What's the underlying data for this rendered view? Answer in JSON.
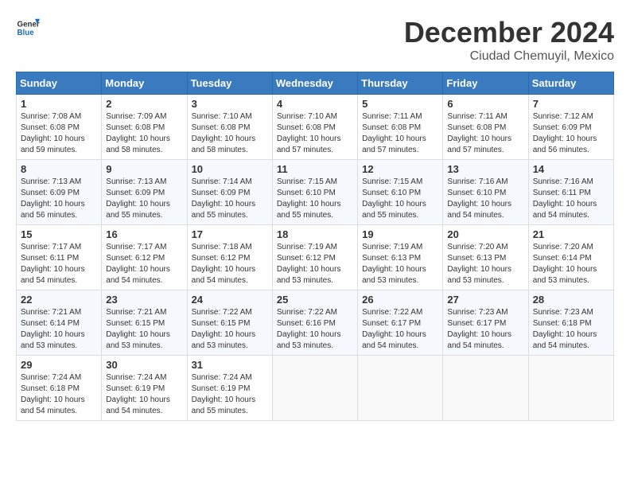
{
  "logo": {
    "general": "General",
    "blue": "Blue"
  },
  "header": {
    "month": "December 2024",
    "location": "Ciudad Chemuyil, Mexico"
  },
  "weekdays": [
    "Sunday",
    "Monday",
    "Tuesday",
    "Wednesday",
    "Thursday",
    "Friday",
    "Saturday"
  ],
  "weeks": [
    [
      {
        "day": "1",
        "sunrise": "Sunrise: 7:08 AM",
        "sunset": "Sunset: 6:08 PM",
        "daylight": "Daylight: 10 hours and 59 minutes."
      },
      {
        "day": "2",
        "sunrise": "Sunrise: 7:09 AM",
        "sunset": "Sunset: 6:08 PM",
        "daylight": "Daylight: 10 hours and 58 minutes."
      },
      {
        "day": "3",
        "sunrise": "Sunrise: 7:10 AM",
        "sunset": "Sunset: 6:08 PM",
        "daylight": "Daylight: 10 hours and 58 minutes."
      },
      {
        "day": "4",
        "sunrise": "Sunrise: 7:10 AM",
        "sunset": "Sunset: 6:08 PM",
        "daylight": "Daylight: 10 hours and 57 minutes."
      },
      {
        "day": "5",
        "sunrise": "Sunrise: 7:11 AM",
        "sunset": "Sunset: 6:08 PM",
        "daylight": "Daylight: 10 hours and 57 minutes."
      },
      {
        "day": "6",
        "sunrise": "Sunrise: 7:11 AM",
        "sunset": "Sunset: 6:08 PM",
        "daylight": "Daylight: 10 hours and 57 minutes."
      },
      {
        "day": "7",
        "sunrise": "Sunrise: 7:12 AM",
        "sunset": "Sunset: 6:09 PM",
        "daylight": "Daylight: 10 hours and 56 minutes."
      }
    ],
    [
      {
        "day": "8",
        "sunrise": "Sunrise: 7:13 AM",
        "sunset": "Sunset: 6:09 PM",
        "daylight": "Daylight: 10 hours and 56 minutes."
      },
      {
        "day": "9",
        "sunrise": "Sunrise: 7:13 AM",
        "sunset": "Sunset: 6:09 PM",
        "daylight": "Daylight: 10 hours and 55 minutes."
      },
      {
        "day": "10",
        "sunrise": "Sunrise: 7:14 AM",
        "sunset": "Sunset: 6:09 PM",
        "daylight": "Daylight: 10 hours and 55 minutes."
      },
      {
        "day": "11",
        "sunrise": "Sunrise: 7:15 AM",
        "sunset": "Sunset: 6:10 PM",
        "daylight": "Daylight: 10 hours and 55 minutes."
      },
      {
        "day": "12",
        "sunrise": "Sunrise: 7:15 AM",
        "sunset": "Sunset: 6:10 PM",
        "daylight": "Daylight: 10 hours and 55 minutes."
      },
      {
        "day": "13",
        "sunrise": "Sunrise: 7:16 AM",
        "sunset": "Sunset: 6:10 PM",
        "daylight": "Daylight: 10 hours and 54 minutes."
      },
      {
        "day": "14",
        "sunrise": "Sunrise: 7:16 AM",
        "sunset": "Sunset: 6:11 PM",
        "daylight": "Daylight: 10 hours and 54 minutes."
      }
    ],
    [
      {
        "day": "15",
        "sunrise": "Sunrise: 7:17 AM",
        "sunset": "Sunset: 6:11 PM",
        "daylight": "Daylight: 10 hours and 54 minutes."
      },
      {
        "day": "16",
        "sunrise": "Sunrise: 7:17 AM",
        "sunset": "Sunset: 6:12 PM",
        "daylight": "Daylight: 10 hours and 54 minutes."
      },
      {
        "day": "17",
        "sunrise": "Sunrise: 7:18 AM",
        "sunset": "Sunset: 6:12 PM",
        "daylight": "Daylight: 10 hours and 54 minutes."
      },
      {
        "day": "18",
        "sunrise": "Sunrise: 7:19 AM",
        "sunset": "Sunset: 6:12 PM",
        "daylight": "Daylight: 10 hours and 53 minutes."
      },
      {
        "day": "19",
        "sunrise": "Sunrise: 7:19 AM",
        "sunset": "Sunset: 6:13 PM",
        "daylight": "Daylight: 10 hours and 53 minutes."
      },
      {
        "day": "20",
        "sunrise": "Sunrise: 7:20 AM",
        "sunset": "Sunset: 6:13 PM",
        "daylight": "Daylight: 10 hours and 53 minutes."
      },
      {
        "day": "21",
        "sunrise": "Sunrise: 7:20 AM",
        "sunset": "Sunset: 6:14 PM",
        "daylight": "Daylight: 10 hours and 53 minutes."
      }
    ],
    [
      {
        "day": "22",
        "sunrise": "Sunrise: 7:21 AM",
        "sunset": "Sunset: 6:14 PM",
        "daylight": "Daylight: 10 hours and 53 minutes."
      },
      {
        "day": "23",
        "sunrise": "Sunrise: 7:21 AM",
        "sunset": "Sunset: 6:15 PM",
        "daylight": "Daylight: 10 hours and 53 minutes."
      },
      {
        "day": "24",
        "sunrise": "Sunrise: 7:22 AM",
        "sunset": "Sunset: 6:15 PM",
        "daylight": "Daylight: 10 hours and 53 minutes."
      },
      {
        "day": "25",
        "sunrise": "Sunrise: 7:22 AM",
        "sunset": "Sunset: 6:16 PM",
        "daylight": "Daylight: 10 hours and 53 minutes."
      },
      {
        "day": "26",
        "sunrise": "Sunrise: 7:22 AM",
        "sunset": "Sunset: 6:17 PM",
        "daylight": "Daylight: 10 hours and 54 minutes."
      },
      {
        "day": "27",
        "sunrise": "Sunrise: 7:23 AM",
        "sunset": "Sunset: 6:17 PM",
        "daylight": "Daylight: 10 hours and 54 minutes."
      },
      {
        "day": "28",
        "sunrise": "Sunrise: 7:23 AM",
        "sunset": "Sunset: 6:18 PM",
        "daylight": "Daylight: 10 hours and 54 minutes."
      }
    ],
    [
      {
        "day": "29",
        "sunrise": "Sunrise: 7:24 AM",
        "sunset": "Sunset: 6:18 PM",
        "daylight": "Daylight: 10 hours and 54 minutes."
      },
      {
        "day": "30",
        "sunrise": "Sunrise: 7:24 AM",
        "sunset": "Sunset: 6:19 PM",
        "daylight": "Daylight: 10 hours and 54 minutes."
      },
      {
        "day": "31",
        "sunrise": "Sunrise: 7:24 AM",
        "sunset": "Sunset: 6:19 PM",
        "daylight": "Daylight: 10 hours and 55 minutes."
      },
      null,
      null,
      null,
      null
    ]
  ]
}
